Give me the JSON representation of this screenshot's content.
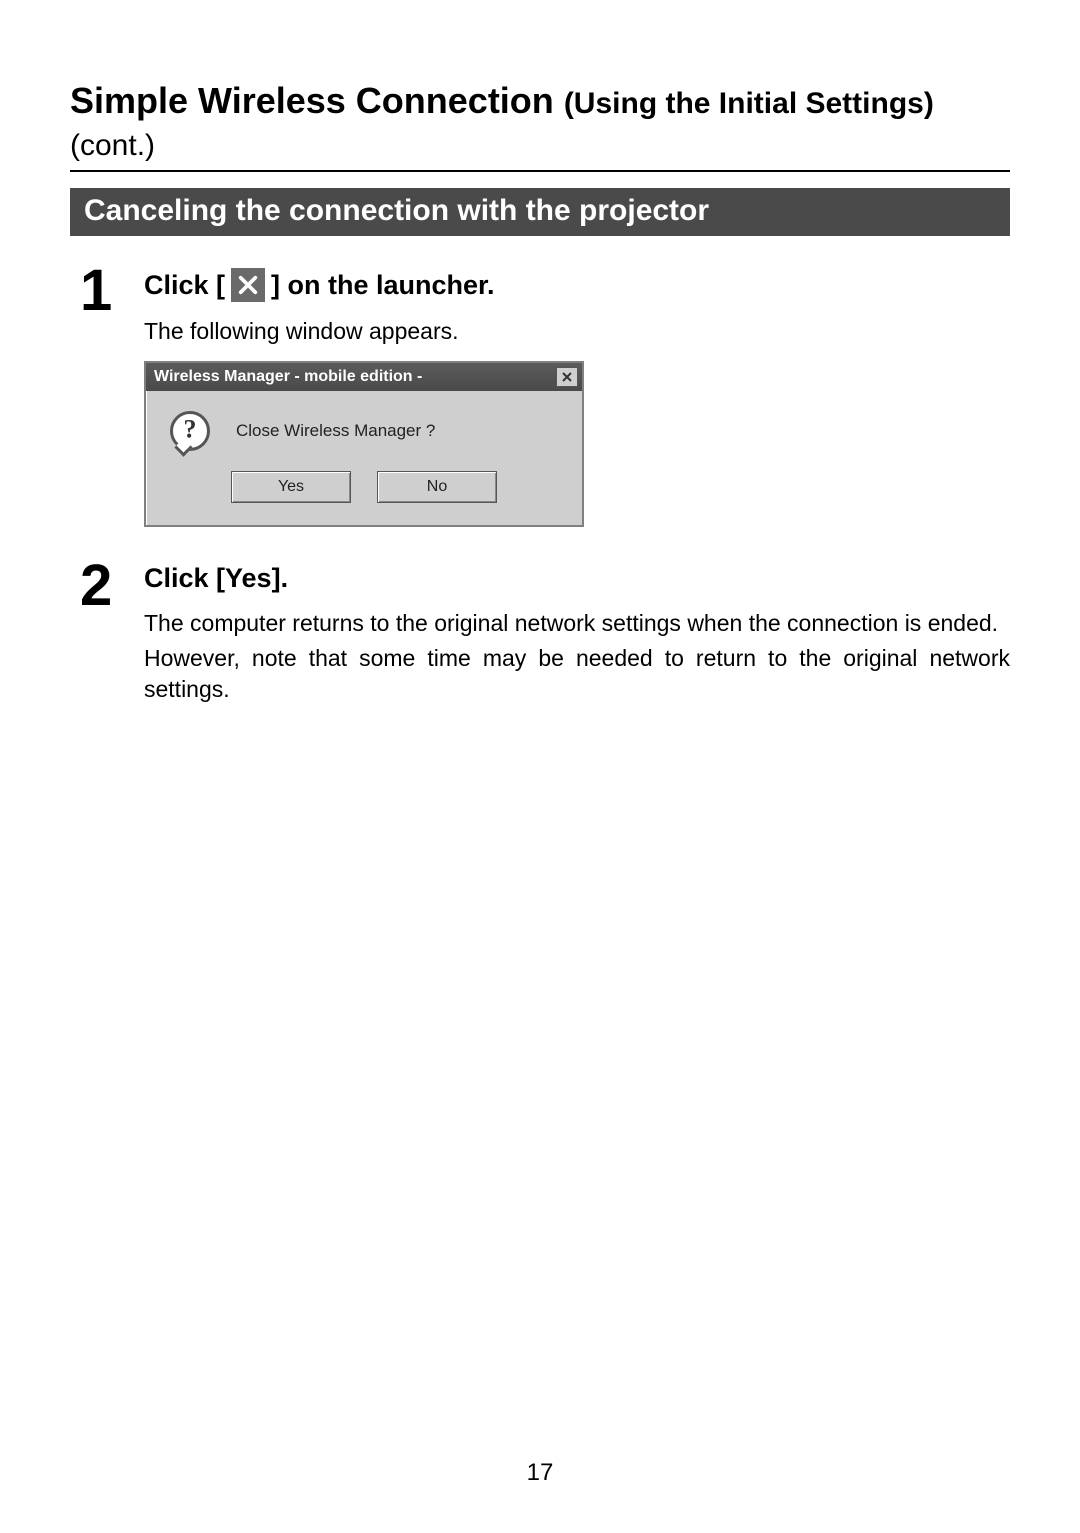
{
  "title": {
    "main": "Simple Wireless Connection",
    "sub1": "(Using the Initial Settings)",
    "sub2": "(cont.)"
  },
  "section_heading": "Canceling the connection with the projector",
  "steps": [
    {
      "num": "1",
      "heading_prefix": "Click [",
      "heading_suffix": "] on the launcher.",
      "intro": "The following window appears.",
      "dialog": {
        "title": "Wireless Manager - mobile edition -",
        "message": "Close Wireless Manager ?",
        "buttons": {
          "yes": "Yes",
          "no": "No"
        }
      }
    },
    {
      "num": "2",
      "heading": "Click [Yes].",
      "paragraphs": [
        "The computer returns to the original network settings when the connection is ended.",
        "However, note that some time may be needed to return to the original network settings."
      ]
    }
  ],
  "page_number": "17"
}
